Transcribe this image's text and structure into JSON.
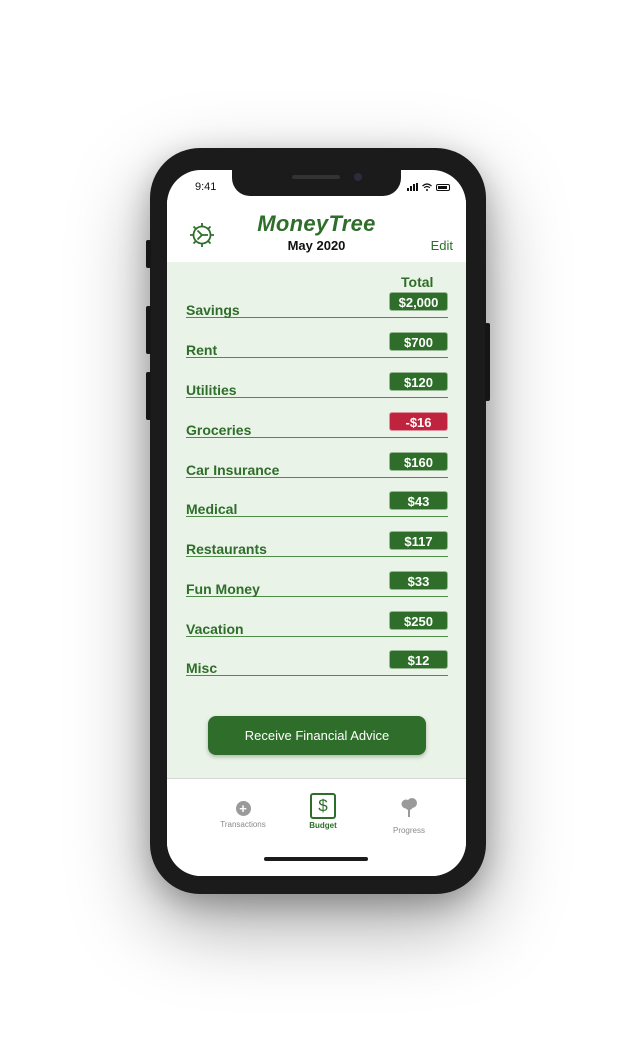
{
  "status_bar": {
    "time": "9:41"
  },
  "header": {
    "settings_icon": "gear-icon",
    "app_title": "MoneyTree",
    "month": "May 2020",
    "edit_label": "Edit"
  },
  "budget": {
    "column_header": "Total",
    "rows": [
      {
        "label": "Savings",
        "amount": "$2,000",
        "status": "positive"
      },
      {
        "label": "Rent",
        "amount": "$700",
        "status": "positive"
      },
      {
        "label": "Utilities",
        "amount": "$120",
        "status": "positive"
      },
      {
        "label": "Groceries",
        "amount": "-$16",
        "status": "negative"
      },
      {
        "label": "Car Insurance",
        "amount": "$160",
        "status": "positive"
      },
      {
        "label": "Medical",
        "amount": "$43",
        "status": "positive"
      },
      {
        "label": "Restaurants",
        "amount": "$117",
        "status": "positive"
      },
      {
        "label": "Fun Money",
        "amount": "$33",
        "status": "positive"
      },
      {
        "label": "Vacation",
        "amount": "$250",
        "status": "positive"
      },
      {
        "label": "Misc",
        "amount": "$12",
        "status": "positive"
      }
    ]
  },
  "advice_button": {
    "label": "Receive Financial  Advice"
  },
  "tabbar": {
    "tabs": [
      {
        "label": "Transactions",
        "icon": "plus-circle-icon",
        "active": false
      },
      {
        "label": "Budget",
        "icon": "dollar-icon",
        "active": true
      },
      {
        "label": "Progress",
        "icon": "tree-icon",
        "active": false
      }
    ]
  },
  "colors": {
    "brand_green": "#2e6e2a",
    "background_green": "#eaf3e7",
    "negative_red": "#c0233e"
  }
}
